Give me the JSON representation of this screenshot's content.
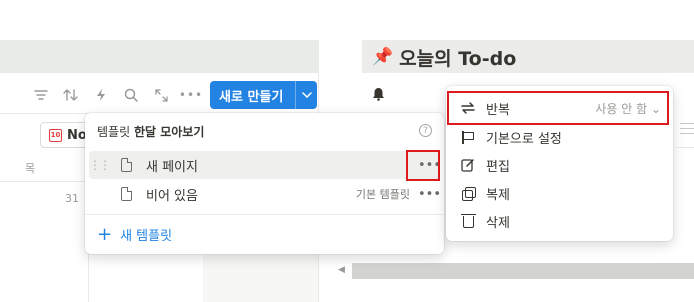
{
  "page": {
    "title": "오늘의 To-do",
    "title_icon": "pushpin-icon"
  },
  "toolbar": {
    "new_button_label": "새로 만들기",
    "icons": [
      "filter-icon",
      "sort-icon",
      "automation-bolt-icon",
      "search-icon",
      "expand-icon",
      "more-icon"
    ]
  },
  "view_chip": {
    "label": "No",
    "icon_text": "10"
  },
  "calendar": {
    "column_label": "목",
    "day_number": "31"
  },
  "template_popover": {
    "header_prefix": "템플릿",
    "header_bold": "한달 모아보기",
    "help_label": "?",
    "items": [
      {
        "name": "새 페이지",
        "badge": "",
        "more": "•••"
      },
      {
        "name": "비어 있음",
        "badge": "기본 템플릿",
        "more": "•••"
      }
    ],
    "new_template_label": "새 템플릿"
  },
  "context_menu": {
    "items": [
      {
        "label": "반복",
        "value": "사용 안 함 ⌄",
        "icon": "repeat-icon"
      },
      {
        "label": "기본으로 설정",
        "icon": "flag-icon"
      },
      {
        "label": "편집",
        "icon": "edit-icon"
      },
      {
        "label": "복제",
        "icon": "duplicate-icon"
      },
      {
        "label": "삭제",
        "icon": "trash-icon"
      }
    ]
  },
  "colors": {
    "accent": "#2383e2",
    "highlight_box": "#e0191c"
  }
}
